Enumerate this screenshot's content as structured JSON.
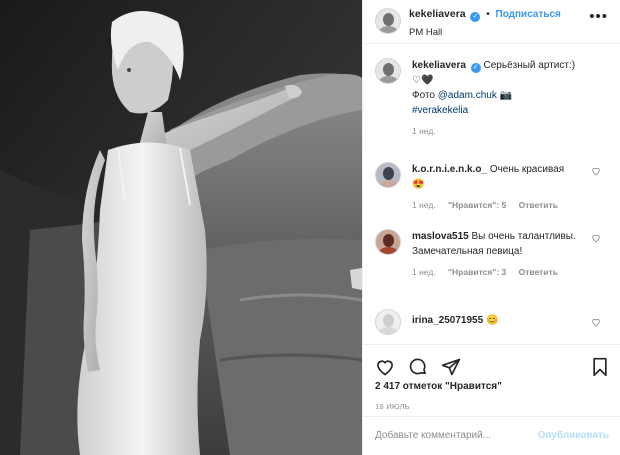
{
  "post": {
    "username": "kekeliavera",
    "follow_label": "Подписаться",
    "dot": "•",
    "location": "PM Hall",
    "more_label": "•••"
  },
  "caption": {
    "username": "kekeliavera",
    "text": "Серьёзный артист:)",
    "hearts": "♡🖤",
    "photo_prefix": "Фото ",
    "photo_mention": "@adam.chuk",
    "camera": "📷",
    "hashtag": "#verakekelia",
    "time": "1 нед."
  },
  "comments": [
    {
      "username": "k.o.r.n.i.e.n.k.o_",
      "text": "Очень красивая",
      "emoji": "😍",
      "time": "1 нед.",
      "likes": "\"Нравится\": 5",
      "reply": "Ответить"
    },
    {
      "username": "maslova515",
      "text": "Вы очень талантливы. Замечательная певица!",
      "time": "1 нед.",
      "likes": "\"Нравится\": 3",
      "reply": "Ответить"
    },
    {
      "username": "irina_25071955",
      "emoji": "😊"
    }
  ],
  "likes_count": "2 417 отметок \"Нравится\"",
  "date": "18 ИЮЛЬ",
  "comment_box": {
    "placeholder": "Добавьте комментарий...",
    "publish": "Опубликовать"
  },
  "icons": {
    "like": "heart-icon",
    "comment": "comment-icon",
    "share": "share-icon",
    "save": "bookmark-icon",
    "verified": "verified-badge-icon"
  },
  "colors": {
    "accent": "#3897f0",
    "text": "#262626",
    "muted": "#8e8e8e",
    "link": "#00376b"
  }
}
